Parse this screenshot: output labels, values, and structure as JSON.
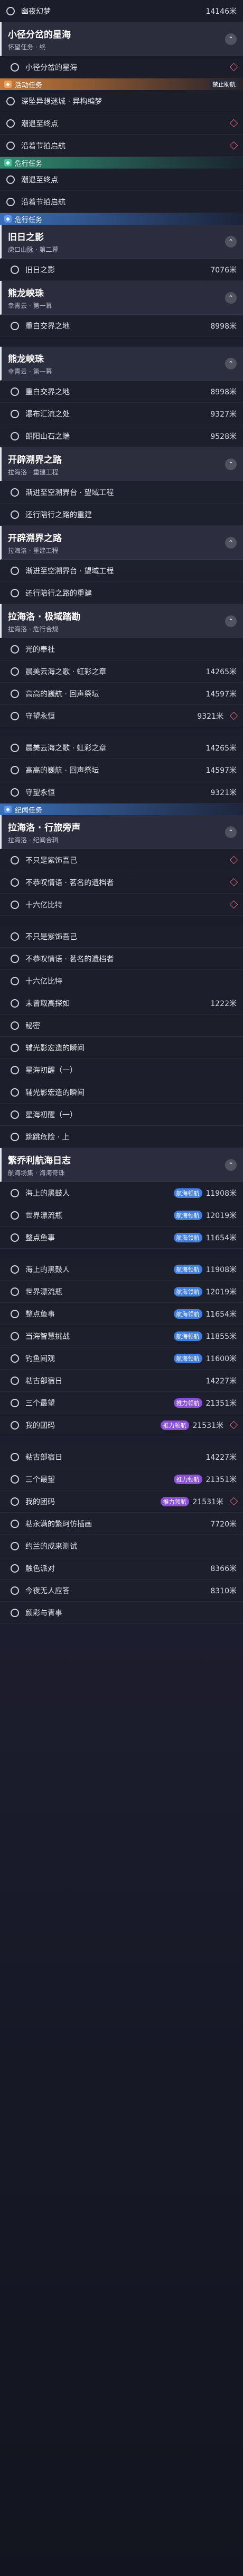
{
  "rows": [
    {
      "kind": "item",
      "text": "幽夜幻梦",
      "dist": "14146米",
      "diamond": false
    },
    {
      "kind": "group",
      "title": "小径分岔的星海",
      "sub": "怀望任务 · 终"
    },
    {
      "kind": "item",
      "text": "小径分岔的星海",
      "dist": "",
      "diamond": true,
      "sub": true
    },
    {
      "kind": "cat",
      "style": "orange",
      "label": "活动任务",
      "extra": "禁止助航"
    },
    {
      "kind": "item",
      "text": "深坠异想迷城 · 异构编梦",
      "dist": "",
      "diamond": false
    },
    {
      "kind": "item",
      "text": "潮退至终点",
      "dist": "",
      "diamond": true
    },
    {
      "kind": "item",
      "text": "沿着节拍启航",
      "dist": "",
      "diamond": true
    },
    {
      "kind": "cat",
      "style": "green",
      "label": "危行任务",
      "extra": ""
    },
    {
      "kind": "item",
      "text": "潮退至终点",
      "dist": "",
      "diamond": false
    },
    {
      "kind": "item",
      "text": "沿着节拍启航",
      "dist": "",
      "diamond": false
    },
    {
      "kind": "cat",
      "style": "blue",
      "label": "危行任务",
      "extra": ""
    },
    {
      "kind": "group",
      "title": "旧日之影",
      "sub": "虎口山脉 · 第二幕"
    },
    {
      "kind": "item",
      "text": "旧日之影",
      "dist": "7076米",
      "diamond": false,
      "sub": true
    },
    {
      "kind": "group",
      "title": "熊龙峡珠",
      "sub": "幸青云 · 第一幕"
    },
    {
      "kind": "item",
      "text": "重白交界之地",
      "dist": "8998米",
      "diamond": false,
      "sub": true
    },
    {
      "kind": "gap"
    },
    {
      "kind": "group",
      "title": "熊龙峡珠",
      "sub": "幸青云 · 第一幕"
    },
    {
      "kind": "item",
      "text": "重白交界之地",
      "dist": "8998米",
      "diamond": false,
      "sub": true
    },
    {
      "kind": "item",
      "text": "瀑布汇流之处",
      "dist": "9327米",
      "diamond": false,
      "sub": true
    },
    {
      "kind": "item",
      "text": "朗阳山石之端",
      "dist": "9528米",
      "diamond": false,
      "sub": true
    },
    {
      "kind": "group",
      "title": "开辟溯界之路",
      "sub": "拉海洛 · 重建工程"
    },
    {
      "kind": "item",
      "text": "渐进至空溯界台 · 望域工程",
      "dist": "",
      "diamond": false,
      "sub": true
    },
    {
      "kind": "item",
      "text": "还行陪行之路的重建",
      "dist": "",
      "diamond": false,
      "sub": true
    },
    {
      "kind": "group",
      "title": "开辟溯界之路",
      "sub": "拉海洛 · 重建工程"
    },
    {
      "kind": "item",
      "text": "渐进至空溯界台 · 望域工程",
      "dist": "",
      "diamond": false,
      "sub": true
    },
    {
      "kind": "item",
      "text": "还行陪行之路的重建",
      "dist": "",
      "diamond": false,
      "sub": true
    },
    {
      "kind": "group",
      "title": "拉海洛 · 极域踏勘",
      "sub": "拉海洛 · 危行合规"
    },
    {
      "kind": "item",
      "text": "光的奉社",
      "dist": "",
      "diamond": false,
      "sub": true
    },
    {
      "kind": "item",
      "text": "晨美云海之歌 · 虹彩之章",
      "dist": "14265米",
      "diamond": false,
      "sub": true
    },
    {
      "kind": "item",
      "text": "高高的巍航 · 回声祭坛",
      "dist": "14597米",
      "diamond": false,
      "sub": true
    },
    {
      "kind": "item",
      "text": "守望永恒",
      "dist": "9321米",
      "diamond": true,
      "sub": true
    },
    {
      "kind": "gap"
    },
    {
      "kind": "item",
      "text": "晨美云海之歌 · 虹彩之章",
      "dist": "14265米",
      "diamond": false,
      "sub": true
    },
    {
      "kind": "item",
      "text": "高高的巍航 · 回声祭坛",
      "dist": "14597米",
      "diamond": false,
      "sub": true
    },
    {
      "kind": "item",
      "text": "守望永恒",
      "dist": "9321米",
      "diamond": false,
      "sub": true
    },
    {
      "kind": "cat",
      "style": "blue",
      "label": "纪闻任务",
      "extra": ""
    },
    {
      "kind": "group",
      "title": "拉海洛 · 行旅旁声",
      "sub": "拉海洛 · 纪闻合辑"
    },
    {
      "kind": "item",
      "text": "不只是紫饰吾己",
      "dist": "",
      "diamond": true,
      "sub": true
    },
    {
      "kind": "item",
      "text": "不恭叹情语 · 茗名的遗档者",
      "dist": "",
      "diamond": true,
      "sub": true
    },
    {
      "kind": "item",
      "text": "十六亿比特",
      "dist": "",
      "diamond": true,
      "sub": true
    },
    {
      "kind": "gap"
    },
    {
      "kind": "item",
      "text": "不只是紫饰吾己",
      "dist": "",
      "diamond": false,
      "sub": true
    },
    {
      "kind": "item",
      "text": "不恭叹情语 · 茗名的遗档者",
      "dist": "",
      "diamond": false,
      "sub": true
    },
    {
      "kind": "item",
      "text": "十六亿比特",
      "dist": "",
      "diamond": false,
      "sub": true
    },
    {
      "kind": "item",
      "text": "未曾取高探如",
      "dist": "1222米",
      "diamond": false,
      "sub": true
    },
    {
      "kind": "item",
      "text": "秘密",
      "dist": "",
      "diamond": false,
      "sub": true
    },
    {
      "kind": "item",
      "text": "辅光影宏造的瞬间",
      "dist": "",
      "diamond": false,
      "sub": true
    },
    {
      "kind": "item",
      "text": "星海初醒（一）",
      "dist": "",
      "diamond": false,
      "sub": true
    },
    {
      "kind": "item",
      "text": "辅光影宏造的瞬间",
      "dist": "",
      "diamond": false,
      "sub": true
    },
    {
      "kind": "item",
      "text": "星海初醒（一）",
      "dist": "",
      "diamond": false,
      "sub": true
    },
    {
      "kind": "item",
      "text": "跳跳危险 · 上",
      "dist": "",
      "diamond": false,
      "sub": true
    },
    {
      "kind": "group",
      "title": "繁乔利航海日志",
      "sub": "航海场集 · 海海奇珠"
    },
    {
      "kind": "item",
      "text": "海上的黑鼓人",
      "dist": "11908米",
      "diamond": false,
      "sub": true,
      "pill": "航海领航",
      "pillStyle": "blue"
    },
    {
      "kind": "item",
      "text": "世界漂流瓶",
      "dist": "12019米",
      "diamond": false,
      "sub": true,
      "pill": "航海领航",
      "pillStyle": "blue"
    },
    {
      "kind": "item",
      "text": "整点鱼事",
      "dist": "11654米",
      "diamond": false,
      "sub": true,
      "pill": "航海领航",
      "pillStyle": "blue"
    },
    {
      "kind": "gap"
    },
    {
      "kind": "item",
      "text": "海上的黑鼓人",
      "dist": "11908米",
      "diamond": false,
      "sub": true,
      "pill": "航海领航",
      "pillStyle": "blue"
    },
    {
      "kind": "item",
      "text": "世界漂流瓶",
      "dist": "12019米",
      "diamond": false,
      "sub": true,
      "pill": "航海领航",
      "pillStyle": "blue"
    },
    {
      "kind": "item",
      "text": "整点鱼事",
      "dist": "11654米",
      "diamond": false,
      "sub": true,
      "pill": "航海领航",
      "pillStyle": "blue"
    },
    {
      "kind": "item",
      "text": "当海智慧挑战",
      "dist": "11855米",
      "diamond": false,
      "sub": true,
      "pill": "航海领航",
      "pillStyle": "blue"
    },
    {
      "kind": "item",
      "text": "钓鱼间观",
      "dist": "11600米",
      "diamond": false,
      "sub": true,
      "pill": "航海领航",
      "pillStyle": "blue"
    },
    {
      "kind": "item",
      "text": "粘古部宿日",
      "dist": "14227米",
      "diamond": false,
      "sub": true,
      "pill": "",
      "pillStyle": ""
    },
    {
      "kind": "item",
      "text": "三个最望",
      "dist": "21351米",
      "diamond": false,
      "sub": true,
      "pill": "推力领航",
      "pillStyle": "purple"
    },
    {
      "kind": "item",
      "text": "我的团码",
      "dist": "21531米",
      "diamond": true,
      "sub": true,
      "pill": "推力领航",
      "pillStyle": "purple"
    },
    {
      "kind": "gap"
    },
    {
      "kind": "item",
      "text": "粘古部宿日",
      "dist": "14227米",
      "diamond": false,
      "sub": true,
      "pill": "",
      "pillStyle": ""
    },
    {
      "kind": "item",
      "text": "三个最望",
      "dist": "21351米",
      "diamond": false,
      "sub": true,
      "pill": "推力领航",
      "pillStyle": "purple"
    },
    {
      "kind": "item",
      "text": "我的团码",
      "dist": "21531米",
      "diamond": true,
      "sub": true,
      "pill": "推力领航",
      "pillStyle": "purple"
    },
    {
      "kind": "item",
      "text": "粘永满的繁珂仿插画",
      "dist": "7720米",
      "diamond": false,
      "sub": true,
      "pill": "",
      "pillStyle": ""
    },
    {
      "kind": "item",
      "text": "约兰的成来测试",
      "dist": "",
      "diamond": false,
      "sub": true,
      "pill": "",
      "pillStyle": ""
    },
    {
      "kind": "item",
      "text": "触色派对",
      "dist": "8366米",
      "diamond": false,
      "sub": true,
      "pill": "",
      "pillStyle": ""
    },
    {
      "kind": "item",
      "text": "今夜无人应答",
      "dist": "8310米",
      "diamond": false,
      "sub": true,
      "pill": "",
      "pillStyle": ""
    },
    {
      "kind": "item",
      "text": "颜彩与青事",
      "dist": "",
      "diamond": false,
      "sub": true,
      "pill": "",
      "pillStyle": ""
    }
  ]
}
